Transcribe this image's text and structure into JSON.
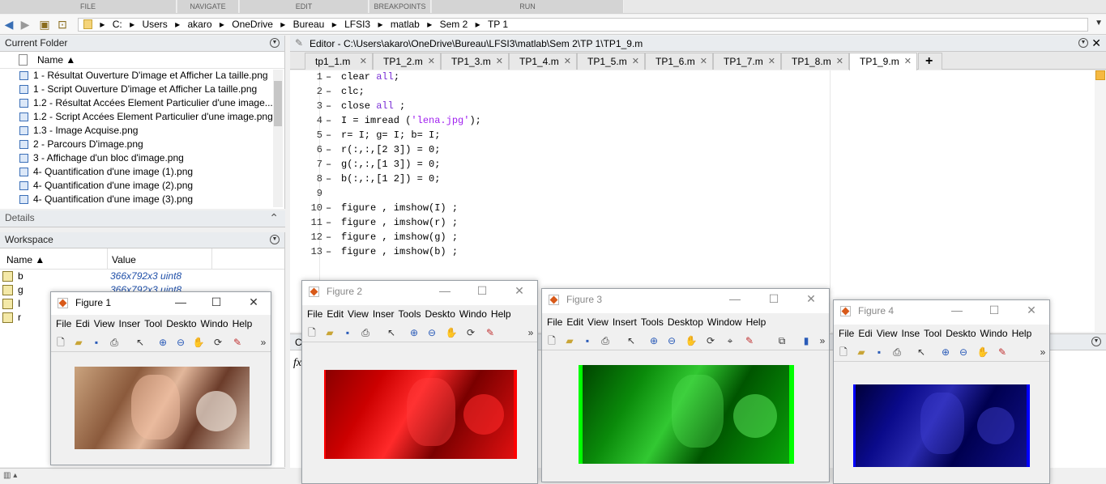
{
  "ribbon": {
    "sections": [
      "FILE",
      "NAVIGATE",
      "EDIT",
      "BREAKPOINTS",
      "RUN"
    ]
  },
  "address": {
    "crumbs": [
      "C:",
      "Users",
      "akaro",
      "OneDrive",
      "Bureau",
      "LFSI3",
      "matlab",
      "Sem 2",
      "TP 1"
    ],
    "separator": "▸"
  },
  "current_folder": {
    "title": "Current Folder",
    "column": "Name ▲",
    "files": [
      "1 -  Résultat Ouverture D'image et Afficher La taille.png",
      "1 - Script Ouverture D'image et Afficher La taille.png",
      "1.2 - Résultat Accées Element Particulier d'une image....",
      "1.2 - Script Accées Element Particulier d'une image.png",
      "1.3 - Image Acquise.png",
      "2 - Parcours D'image.png",
      "3 - Affichage d'un bloc d'image.png",
      "4- Quantification d'une image (1).png",
      "4- Quantification d'une image (2).png",
      "4- Quantification d'une image (3).png"
    ]
  },
  "details": {
    "title": "Details"
  },
  "workspace": {
    "title": "Workspace",
    "col_name": "Name ▲",
    "col_value": "Value",
    "vars": [
      {
        "name": "b",
        "value": "366x792x3 uint8"
      },
      {
        "name": "g",
        "value": "366x792x3 uint8"
      },
      {
        "name": "I",
        "value": ""
      },
      {
        "name": "r",
        "value": ""
      }
    ]
  },
  "editor": {
    "title": "Editor - C:\\Users\\akaro\\OneDrive\\Bureau\\LFSI3\\matlab\\Sem 2\\TP 1\\TP1_9.m",
    "tabs": [
      "tp1_1.m",
      "TP1_2.m",
      "TP1_3.m",
      "TP1_4.m",
      "TP1_5.m",
      "TP1_6.m",
      "TP1_7.m",
      "TP1_8.m",
      "TP1_9.m"
    ],
    "active_tab": "TP1_9.m",
    "lines": [
      {
        "n": "1",
        "d": "–",
        "parts": [
          [
            "clear ",
            ""
          ],
          [
            "all",
            "kw"
          ],
          [
            ";",
            ""
          ]
        ]
      },
      {
        "n": "2",
        "d": "–",
        "parts": [
          [
            "clc;",
            ""
          ]
        ]
      },
      {
        "n": "3",
        "d": "–",
        "parts": [
          [
            "close ",
            ""
          ],
          [
            "all",
            "kw"
          ],
          [
            " ;",
            ""
          ]
        ]
      },
      {
        "n": "4",
        "d": "–",
        "parts": [
          [
            "I = imread (",
            ""
          ],
          [
            "'lena.jpg'",
            "str"
          ],
          [
            ");",
            ""
          ]
        ]
      },
      {
        "n": "5",
        "d": "–",
        "parts": [
          [
            "r= I; g= I; b= I;",
            ""
          ]
        ]
      },
      {
        "n": "6",
        "d": "–",
        "parts": [
          [
            "r(:,:,[2 3]) = 0;",
            ""
          ]
        ]
      },
      {
        "n": "7",
        "d": "–",
        "parts": [
          [
            "g(:,:,[1 3]) = 0;",
            ""
          ]
        ]
      },
      {
        "n": "8",
        "d": "–",
        "parts": [
          [
            "b(:,:,[1 2]) = 0;",
            ""
          ]
        ]
      },
      {
        "n": "9",
        "d": "",
        "parts": []
      },
      {
        "n": "10",
        "d": "–",
        "parts": [
          [
            "figure , imshow(I) ;",
            ""
          ]
        ]
      },
      {
        "n": "11",
        "d": "–",
        "parts": [
          [
            "figure , imshow(r) ;",
            ""
          ]
        ]
      },
      {
        "n": "12",
        "d": "–",
        "parts": [
          [
            "figure , imshow(g) ;",
            ""
          ]
        ]
      },
      {
        "n": "13",
        "d": "–",
        "parts": [
          [
            "figure , imshow(b) ;",
            ""
          ]
        ]
      }
    ]
  },
  "command": {
    "prompt": "fx"
  },
  "figures": [
    {
      "title": "Figure 1",
      "menu": [
        "File",
        "Edi",
        "View",
        "Inser",
        "Tool",
        "Deskto",
        "Windo",
        "Help"
      ]
    },
    {
      "title": "Figure 2",
      "menu": [
        "File",
        "Edit",
        "View",
        "Inser",
        "Tools",
        "Deskto",
        "Windo",
        "Help"
      ]
    },
    {
      "title": "Figure 3",
      "menu": [
        "File",
        "Edit",
        "View",
        "Insert",
        "Tools",
        "Desktop",
        "Window",
        "Help"
      ]
    },
    {
      "title": "Figure 4",
      "menu": [
        "File",
        "Edi",
        "View",
        "Inse",
        "Tool",
        "Deskto",
        "Windo",
        "Help"
      ]
    }
  ],
  "colors": {
    "red_channel": "#cc0000",
    "green_channel": "#009900",
    "blue_channel": "#0a0a9a"
  }
}
